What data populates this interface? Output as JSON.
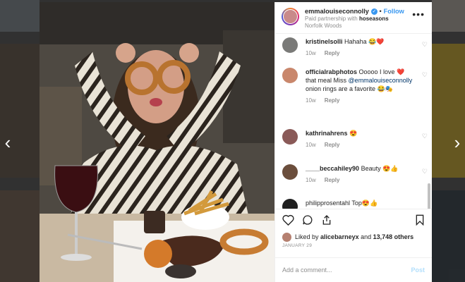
{
  "nav": {
    "prev_glyph": "‹",
    "next_glyph": "›"
  },
  "post": {
    "username": "emmalouiseconnolly",
    "verified_glyph": "✓",
    "follow_label": "Follow",
    "sponsor_prefix": "Paid partnership with",
    "sponsor": "hoseasons",
    "location": "Norfolk Woods",
    "more_glyph": "•••",
    "likes_prefix": "Liked by",
    "likes_user": "alicebarneyx",
    "likes_suffix": "and",
    "likes_count": "13,748 others",
    "date": "JANUARY 29",
    "comment_placeholder": "Add a comment...",
    "post_label": "Post"
  },
  "comments": [
    {
      "user": "kristinelsolli",
      "text": "Hahaha 😂❤️",
      "age": "10w",
      "reply": "Reply",
      "avatar_color": "#7a7a78"
    },
    {
      "user": "officialrabphotos",
      "text_pre": "Ooooo I love ❤️ that meal Miss",
      "mention": "@emmalouiseconnolly",
      "text_post": "onion rings are a favorite 😂🎭",
      "age": "10w",
      "reply": "Reply",
      "avatar_color": "#c9876c"
    },
    {
      "user": "kathrinahrens",
      "text": "😍",
      "age": "10w",
      "reply": "Reply",
      "avatar_color": "#8a5a58"
    },
    {
      "user": "____beccahiley90",
      "text": "Beauty 😍👍",
      "age": "10w",
      "reply": "Reply",
      "avatar_color": "#6b4e3c"
    },
    {
      "user": "philipprosentahl",
      "text": "Top😍👍",
      "age": "",
      "reply": "",
      "avatar_color": "#1f1f1f"
    }
  ],
  "colors": {
    "link": "#3897f0",
    "text": "#262626",
    "muted": "#8e8e8e"
  }
}
